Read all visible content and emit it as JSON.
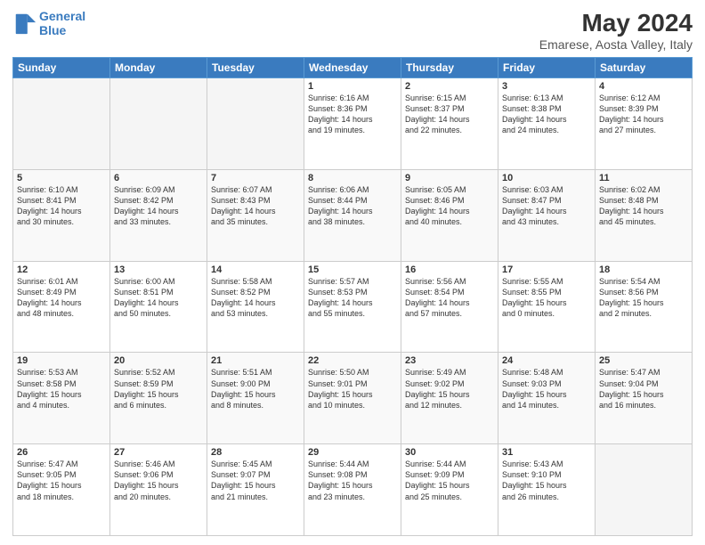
{
  "logo": {
    "line1": "General",
    "line2": "Blue"
  },
  "title": "May 2024",
  "subtitle": "Emarese, Aosta Valley, Italy",
  "days_of_week": [
    "Sunday",
    "Monday",
    "Tuesday",
    "Wednesday",
    "Thursday",
    "Friday",
    "Saturday"
  ],
  "weeks": [
    [
      {
        "day": "",
        "info": ""
      },
      {
        "day": "",
        "info": ""
      },
      {
        "day": "",
        "info": ""
      },
      {
        "day": "1",
        "info": "Sunrise: 6:16 AM\nSunset: 8:36 PM\nDaylight: 14 hours\nand 19 minutes."
      },
      {
        "day": "2",
        "info": "Sunrise: 6:15 AM\nSunset: 8:37 PM\nDaylight: 14 hours\nand 22 minutes."
      },
      {
        "day": "3",
        "info": "Sunrise: 6:13 AM\nSunset: 8:38 PM\nDaylight: 14 hours\nand 24 minutes."
      },
      {
        "day": "4",
        "info": "Sunrise: 6:12 AM\nSunset: 8:39 PM\nDaylight: 14 hours\nand 27 minutes."
      }
    ],
    [
      {
        "day": "5",
        "info": "Sunrise: 6:10 AM\nSunset: 8:41 PM\nDaylight: 14 hours\nand 30 minutes."
      },
      {
        "day": "6",
        "info": "Sunrise: 6:09 AM\nSunset: 8:42 PM\nDaylight: 14 hours\nand 33 minutes."
      },
      {
        "day": "7",
        "info": "Sunrise: 6:07 AM\nSunset: 8:43 PM\nDaylight: 14 hours\nand 35 minutes."
      },
      {
        "day": "8",
        "info": "Sunrise: 6:06 AM\nSunset: 8:44 PM\nDaylight: 14 hours\nand 38 minutes."
      },
      {
        "day": "9",
        "info": "Sunrise: 6:05 AM\nSunset: 8:46 PM\nDaylight: 14 hours\nand 40 minutes."
      },
      {
        "day": "10",
        "info": "Sunrise: 6:03 AM\nSunset: 8:47 PM\nDaylight: 14 hours\nand 43 minutes."
      },
      {
        "day": "11",
        "info": "Sunrise: 6:02 AM\nSunset: 8:48 PM\nDaylight: 14 hours\nand 45 minutes."
      }
    ],
    [
      {
        "day": "12",
        "info": "Sunrise: 6:01 AM\nSunset: 8:49 PM\nDaylight: 14 hours\nand 48 minutes."
      },
      {
        "day": "13",
        "info": "Sunrise: 6:00 AM\nSunset: 8:51 PM\nDaylight: 14 hours\nand 50 minutes."
      },
      {
        "day": "14",
        "info": "Sunrise: 5:58 AM\nSunset: 8:52 PM\nDaylight: 14 hours\nand 53 minutes."
      },
      {
        "day": "15",
        "info": "Sunrise: 5:57 AM\nSunset: 8:53 PM\nDaylight: 14 hours\nand 55 minutes."
      },
      {
        "day": "16",
        "info": "Sunrise: 5:56 AM\nSunset: 8:54 PM\nDaylight: 14 hours\nand 57 minutes."
      },
      {
        "day": "17",
        "info": "Sunrise: 5:55 AM\nSunset: 8:55 PM\nDaylight: 15 hours\nand 0 minutes."
      },
      {
        "day": "18",
        "info": "Sunrise: 5:54 AM\nSunset: 8:56 PM\nDaylight: 15 hours\nand 2 minutes."
      }
    ],
    [
      {
        "day": "19",
        "info": "Sunrise: 5:53 AM\nSunset: 8:58 PM\nDaylight: 15 hours\nand 4 minutes."
      },
      {
        "day": "20",
        "info": "Sunrise: 5:52 AM\nSunset: 8:59 PM\nDaylight: 15 hours\nand 6 minutes."
      },
      {
        "day": "21",
        "info": "Sunrise: 5:51 AM\nSunset: 9:00 PM\nDaylight: 15 hours\nand 8 minutes."
      },
      {
        "day": "22",
        "info": "Sunrise: 5:50 AM\nSunset: 9:01 PM\nDaylight: 15 hours\nand 10 minutes."
      },
      {
        "day": "23",
        "info": "Sunrise: 5:49 AM\nSunset: 9:02 PM\nDaylight: 15 hours\nand 12 minutes."
      },
      {
        "day": "24",
        "info": "Sunrise: 5:48 AM\nSunset: 9:03 PM\nDaylight: 15 hours\nand 14 minutes."
      },
      {
        "day": "25",
        "info": "Sunrise: 5:47 AM\nSunset: 9:04 PM\nDaylight: 15 hours\nand 16 minutes."
      }
    ],
    [
      {
        "day": "26",
        "info": "Sunrise: 5:47 AM\nSunset: 9:05 PM\nDaylight: 15 hours\nand 18 minutes."
      },
      {
        "day": "27",
        "info": "Sunrise: 5:46 AM\nSunset: 9:06 PM\nDaylight: 15 hours\nand 20 minutes."
      },
      {
        "day": "28",
        "info": "Sunrise: 5:45 AM\nSunset: 9:07 PM\nDaylight: 15 hours\nand 21 minutes."
      },
      {
        "day": "29",
        "info": "Sunrise: 5:44 AM\nSunset: 9:08 PM\nDaylight: 15 hours\nand 23 minutes."
      },
      {
        "day": "30",
        "info": "Sunrise: 5:44 AM\nSunset: 9:09 PM\nDaylight: 15 hours\nand 25 minutes."
      },
      {
        "day": "31",
        "info": "Sunrise: 5:43 AM\nSunset: 9:10 PM\nDaylight: 15 hours\nand 26 minutes."
      },
      {
        "day": "",
        "info": ""
      }
    ]
  ]
}
